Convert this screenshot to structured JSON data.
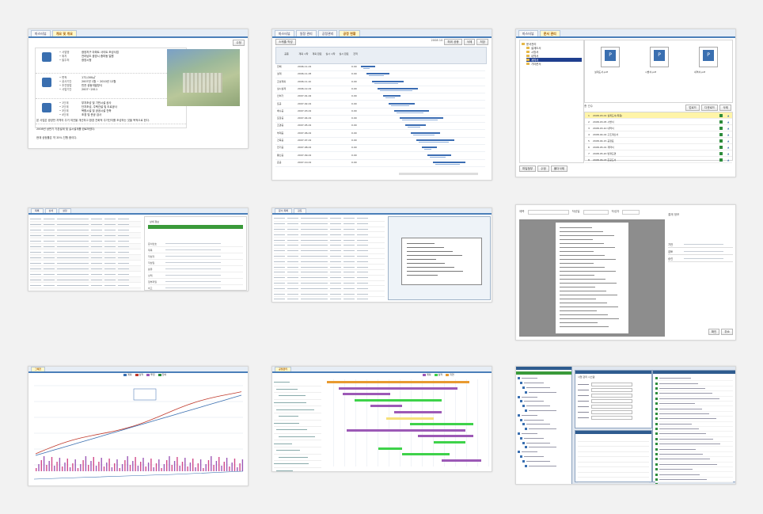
{
  "tile1": {
    "tabs": [
      "마스터뷰",
      "개요 및 개요"
    ],
    "button": "수정",
    "info_groups": [
      {
        "fields": [
          {
            "label": "사업명",
            "value": "광양지구 아파트 사이트 조성사업"
          },
          {
            "label": "위치",
            "value": "전라남도 광양시 중마동 일원"
          },
          {
            "label": "발주처",
            "value": "광양시청"
          }
        ]
      },
      {
        "fields": [
          {
            "label": "면적",
            "value": "172,000㎡"
          },
          {
            "label": "공사기간",
            "value": "2007년 1월 ~ 2010년 12월"
          },
          {
            "label": "추진방법",
            "value": "민관 공동개발방식"
          },
          {
            "label": "사업기간",
            "value": "2007~2011"
          }
        ]
      },
      {
        "fields": [
          {
            "label": "1단계",
            "value": "부지조성 및 기반시설 공사"
          },
          {
            "label": "2단계",
            "value": "단지조성, 주택건설 및 도로공사"
          },
          {
            "label": "3단계",
            "value": "복합시설 및 공공시설 건축"
          },
          {
            "label": "4단계",
            "value": "조경 및 준공 검사"
          }
        ]
      }
    ],
    "paragraphs": [
      "본 사업은 광양만 지역의 주거 여건을 개선하고 환경 친화적 주거단지를 조성하는 것을 목적으로 한다.",
      "2008년 상반기 기본설계 및 실시설계를 완료하였다.",
      "현재 공정률은 약 35% 진행 중이다."
    ]
  },
  "tile2": {
    "tabs": [
      "마스터뷰",
      "일정 관리",
      "공정관리",
      "공정 현황"
    ],
    "toolbar": [
      "스케줄 작성",
      "하위 공종",
      "삭제",
      "저장"
    ],
    "header_date": "2008 10",
    "columns": [
      "공종",
      "계획 시작",
      "계획 완료",
      "실시 시작",
      "실시 완료",
      "진척"
    ],
    "rows": [
      {
        "name": "전체",
        "dates": "2006-11-01"
      },
      {
        "name": "설계",
        "dates": "2006-11-05"
      },
      {
        "name": "조성계획",
        "dates": "2006-11-10"
      },
      {
        "name": "실시설계",
        "dates": "2006-12-01"
      },
      {
        "name": "인허가",
        "dates": "2007-01-02"
      },
      {
        "name": "토공",
        "dates": "2007-02-01"
      },
      {
        "name": "배수공",
        "dates": "2007-03-01"
      },
      {
        "name": "포장공",
        "dates": "2007-04-01"
      },
      {
        "name": "조경공",
        "dates": "2007-05-01"
      },
      {
        "name": "부대공",
        "dates": "2007-06-01"
      },
      {
        "name": "건축공",
        "dates": "2007-07-01"
      },
      {
        "name": "전기공",
        "dates": "2007-08-01"
      },
      {
        "name": "통신공",
        "dates": "2007-09-01"
      },
      {
        "name": "준공",
        "dates": "2007-10-01"
      }
    ],
    "progress": "0.00"
  },
  "tile3": {
    "tabs": [
      "마스터뷰",
      "문서 관리"
    ],
    "tree": [
      "문서관리",
      "설계도서",
      "시방서",
      "내역서",
      "계약서",
      "기타문서"
    ],
    "files": [
      "설계도서.pdf",
      "시방서.pdf",
      "내역서.pdf"
    ],
    "toolbar": [
      "업로드",
      "다운로드",
      "삭제"
    ],
    "count_label": "총 건수",
    "table_rows": [
      "2008-03-01 설계도서(최종)",
      "2008-03-05 시방서",
      "2008-03-10 내역서",
      "2008-04-02 구조계산서",
      "2008-04-15 공정표",
      "2008-05-01 계약서",
      "2008-05-20 변경도면",
      "2008-06-03 준공도서"
    ],
    "buttons": [
      "파일첨부",
      "수정",
      "폴더삭제"
    ]
  },
  "tile4": {
    "tabs": [
      "목록",
      "상세",
      "설정"
    ],
    "section_title": "상세 정보",
    "fields": [
      "문서번호",
      "제목",
      "작성자",
      "작성일",
      "분류",
      "상태",
      "첨부파일",
      "비고"
    ]
  },
  "tile5": {
    "tabs": [
      "문서 목록",
      "검토"
    ]
  },
  "tile6": {
    "labels": [
      "제목",
      "작성일",
      "작성자",
      "결재"
    ],
    "panel_title": "결재 정보",
    "panel_rows": [
      "기안",
      "검토",
      "승인"
    ],
    "buttons": [
      "확인",
      "취소"
    ]
  },
  "tile7": {
    "tabs": [
      "그래프"
    ],
    "legend": [
      "계획",
      "실적",
      "투입",
      "잔여"
    ]
  },
  "tile8": {
    "tabs": [
      "공정관리"
    ],
    "legend": [
      "계획",
      "실적",
      "지연"
    ]
  },
  "tile9": {
    "label": "사업 관리 시스템"
  },
  "colors": {
    "accent": "#4a7fb9",
    "tab_active": "#fff8cc",
    "bar": "#3b6db3",
    "purple": "#9c59b6",
    "green": "#3ed24a",
    "orange": "#e89a30"
  }
}
